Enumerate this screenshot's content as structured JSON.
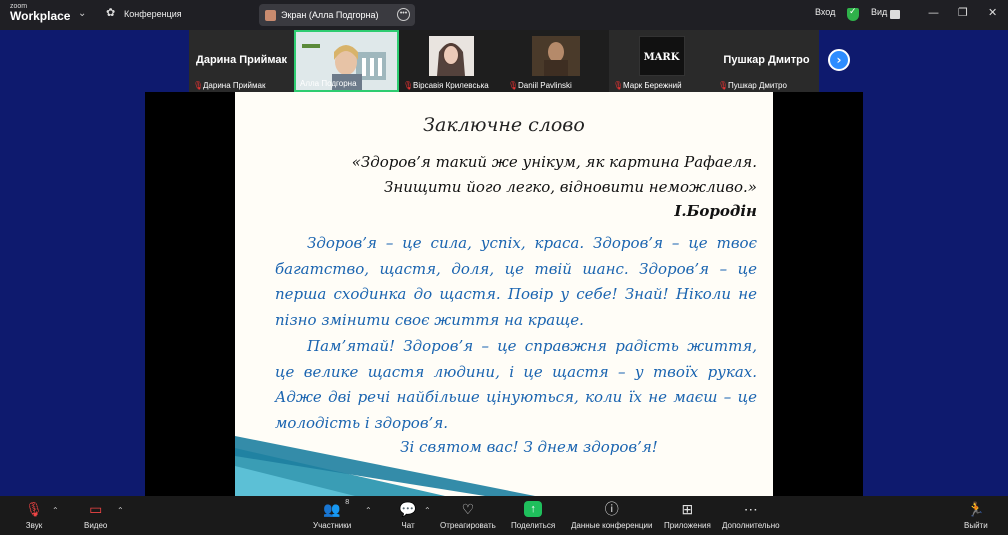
{
  "titlebar": {
    "logo_line1": "zoom",
    "logo_line2": "Workplace",
    "conference": "Конференция",
    "screen_share": "Экран (Алла Подгорна)",
    "login": "Вход",
    "view": "Вид"
  },
  "participants": {
    "tiles": [
      {
        "big_name": "Дарина Приймак",
        "label": "Дарина Приймак"
      },
      {
        "big_name": "",
        "label": "Алла Подгорна"
      },
      {
        "big_name": "",
        "label": "Вірсавія Крилевська"
      },
      {
        "big_name": "",
        "label": "Daniil Pavlinski"
      },
      {
        "big_name": "MARK",
        "label": "Марк Бережний"
      },
      {
        "big_name": "Пушкар Дмитро",
        "label": "Пушкар Дмитро"
      }
    ]
  },
  "slide": {
    "title": "Заключне слово",
    "quote_line1": "«Здоров’я такий же унікум, як картина Рафаеля.",
    "quote_line2": "Знищити його легко, відновити неможливо.»",
    "author": "І.Бородін",
    "paragraph1": "Здоров’я – це сила, успіх, краса. Здоров’я – це твоє багатство, щастя, доля, це твій шанс. Здоров’я – це перша сходинка до щастя. Повір у себе! Знай! Ніколи не пізно змінити своє життя на краще.",
    "paragraph2": "Пам’ятай! Здоров’я – це справжня радість життя, це велике щастя людини, і це щастя – у твоїх руках. Адже дві речі найбільше цінуються, коли їх не маєш – це молодість і здоров’я.",
    "closing": "Зі святом вас! З днем здоров’я!"
  },
  "toolbar": {
    "audio": "Звук",
    "video": "Видео",
    "participants": "Участники",
    "participants_count": "8",
    "chat": "Чат",
    "react": "Отреагировать",
    "share": "Поделиться",
    "info": "Данные конференции",
    "apps": "Приложения",
    "more": "Дополнительно",
    "leave": "Выйти"
  },
  "colors": {
    "background_blue": "#0e1a6e",
    "slide_text_blue": "#1a64b0",
    "active_speaker": "#2ecc71",
    "share_green": "#1fbf5c"
  }
}
